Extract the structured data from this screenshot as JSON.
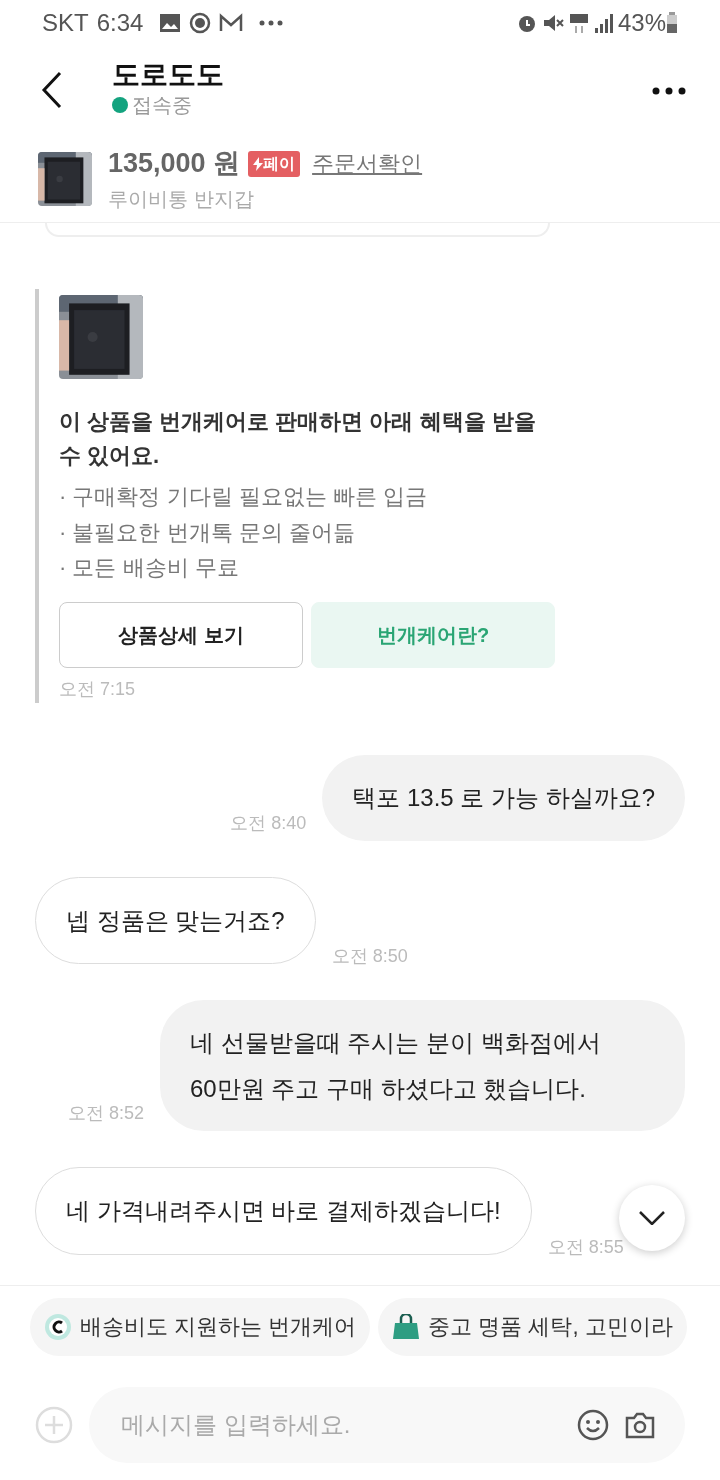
{
  "status_bar": {
    "carrier": "SKT",
    "time": "6:34",
    "battery": "43%"
  },
  "header": {
    "title": "도로도도",
    "status": "접속중",
    "online": true
  },
  "product": {
    "price": "135,000",
    "unit": "원",
    "pay_badge": "페이",
    "order_link": "주문서확인",
    "name": "루이비통 반지갑"
  },
  "messages": [
    {
      "kind": "card",
      "title": "이 상품을 번개케어로 판매하면 아래 혜택을 받을 수 있어요.",
      "bullets": [
        "· 구매확정 기다릴 필요없는 빠른 입금",
        "· 불필요한 번개톡 문의 줄어듦",
        "· 모든 배송비 무료"
      ],
      "buttons": [
        "상품상세 보기",
        "번개케어란?"
      ],
      "time": "오전 7:15"
    },
    {
      "kind": "sent",
      "text": "택포 13.5 로 가능 하실까요?",
      "time": "오전 8:40"
    },
    {
      "kind": "received",
      "text": "넵 정품은 맞는거죠?",
      "time": "오전 8:50"
    },
    {
      "kind": "sent",
      "text": "네 선물받을때 주시는 분이 백화점에서 60만원 주고 구매 하셨다고 했습니다.",
      "time": "오전 8:52"
    },
    {
      "kind": "received",
      "text": "네 가격내려주시면 바로 결제하겠습니다!",
      "time": "오전 8:55"
    }
  ],
  "chips": [
    {
      "kind": "care",
      "text": "배송비도 지원하는 번개케어"
    },
    {
      "kind": "bag",
      "text": "중고 명품 세탁, 고민이라"
    }
  ],
  "input": {
    "placeholder": "메시지를 입력하세요."
  }
}
